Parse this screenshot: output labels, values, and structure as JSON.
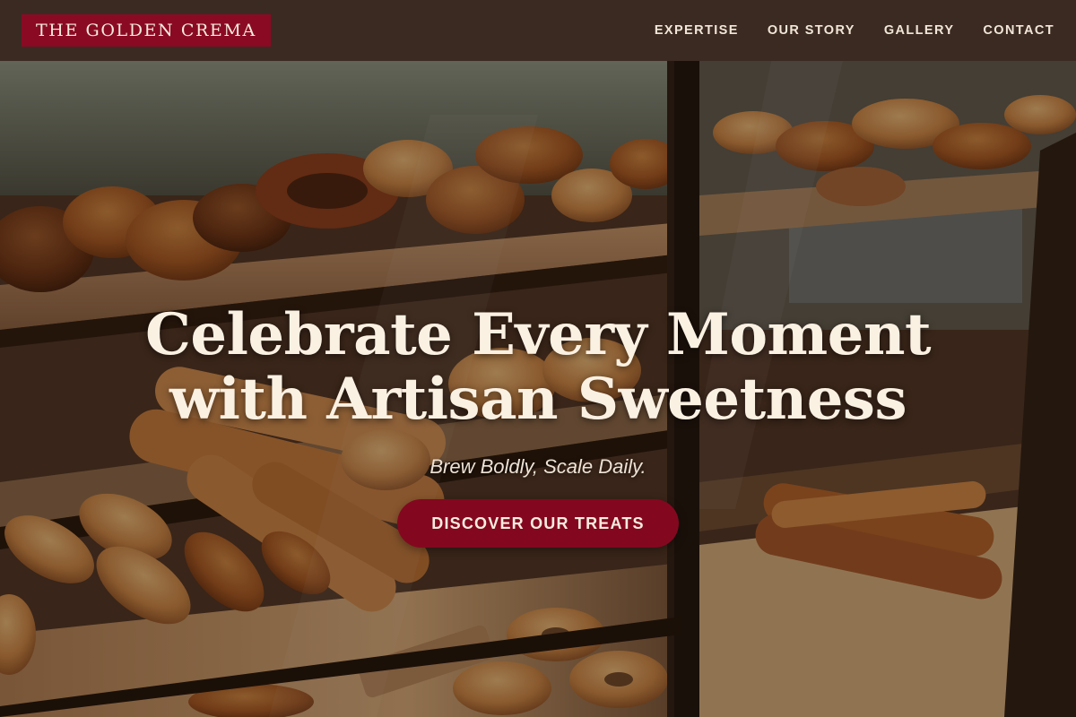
{
  "header": {
    "brand": "THE GOLDEN CREMA",
    "nav": [
      "EXPERTISE",
      "OUR STORY",
      "GALLERY",
      "CONTACT"
    ]
  },
  "hero": {
    "title_line1": "Celebrate Every Moment",
    "title_line2": "with Artisan Sweetness",
    "tagline": "Brew Boldly, Scale Daily.",
    "cta_label": "DISCOVER OUR TREATS"
  },
  "colors": {
    "header_bg": "#3b2a21",
    "brand_bg": "#8a0a24",
    "accent": "#83081f",
    "text_light": "#fbf1e3"
  }
}
